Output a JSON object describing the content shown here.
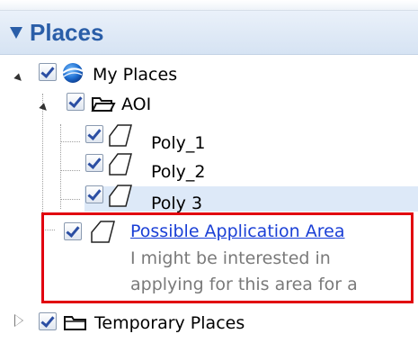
{
  "panel": {
    "title": "Places"
  },
  "tree": {
    "my_places": "My Places",
    "aoi": "AOI",
    "poly_1": "Poly_1",
    "poly_2": "Poly_2",
    "poly_3": "Poly 3",
    "possible_area": {
      "title": "Possible Application Area",
      "description_line1": "I might be interested in",
      "description_line2": "applying for this area for a"
    },
    "temporary_places": "Temporary Places"
  },
  "colors": {
    "header_text": "#2a5ea8",
    "link": "#1a3fd6",
    "highlight_box": "#e1000f",
    "selected_row": "#dde9f8"
  },
  "icons": [
    "globe-icon",
    "folder-open-icon",
    "polygon-icon",
    "folder-icon",
    "checkbox-icon"
  ]
}
